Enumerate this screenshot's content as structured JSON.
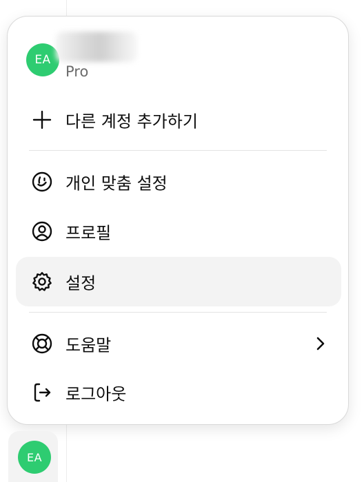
{
  "account": {
    "avatar_initials": "EA",
    "plan": "Pro",
    "avatar_color": "#2ecc71"
  },
  "menu": {
    "items": [
      {
        "label": "다른 계정 추가하기",
        "icon": "plus-icon"
      },
      {
        "label": "개인 맞춤 설정",
        "icon": "personalize-icon"
      },
      {
        "label": "프로필",
        "icon": "profile-icon"
      },
      {
        "label": "설정",
        "icon": "gear-icon",
        "active": true
      },
      {
        "label": "도움말",
        "icon": "lifebuoy-icon",
        "has_submenu": true
      },
      {
        "label": "로그아웃",
        "icon": "logout-icon"
      }
    ]
  },
  "sidebar_footer": {
    "avatar_initials": "EA"
  },
  "colors": {
    "active_item_bg": "#f3f3f3",
    "divider": "#e3e3e3"
  }
}
